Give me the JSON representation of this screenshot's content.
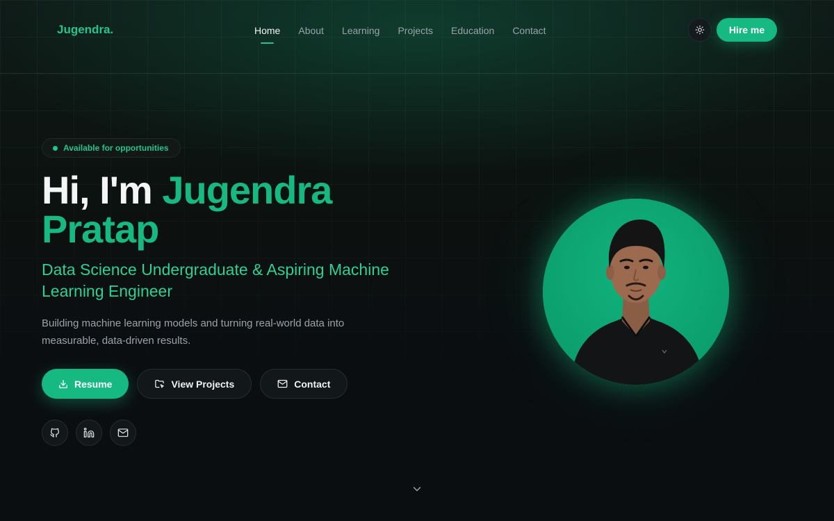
{
  "brand": "Jugendra.",
  "nav": {
    "items": [
      {
        "label": "Home",
        "active": true
      },
      {
        "label": "About",
        "active": false
      },
      {
        "label": "Learning",
        "active": false
      },
      {
        "label": "Projects",
        "active": false
      },
      {
        "label": "Education",
        "active": false
      },
      {
        "label": "Contact",
        "active": false
      }
    ],
    "theme_icon": "sun-icon",
    "hire_label": "Hire me"
  },
  "hero": {
    "badge": "Available for opportunities",
    "title_prefix": "Hi, I'm ",
    "title_name_line1": "Jugendra",
    "title_name_line2": "Pratap",
    "subtitle": "Data Science Undergraduate & Aspiring Machine Learning Engineer",
    "description": "Building machine learning models and turning real-world data into measurable, data-driven results.",
    "buttons": {
      "resume": "Resume",
      "projects": "View Projects",
      "contact": "Contact"
    },
    "socials": [
      "github-icon",
      "linkedin-icon",
      "mail-icon"
    ],
    "scroll_icon": "chevron-down-icon"
  },
  "colors": {
    "accent": "#16b981",
    "background": "#0b0e11",
    "muted_text": "#9aa3ab"
  }
}
